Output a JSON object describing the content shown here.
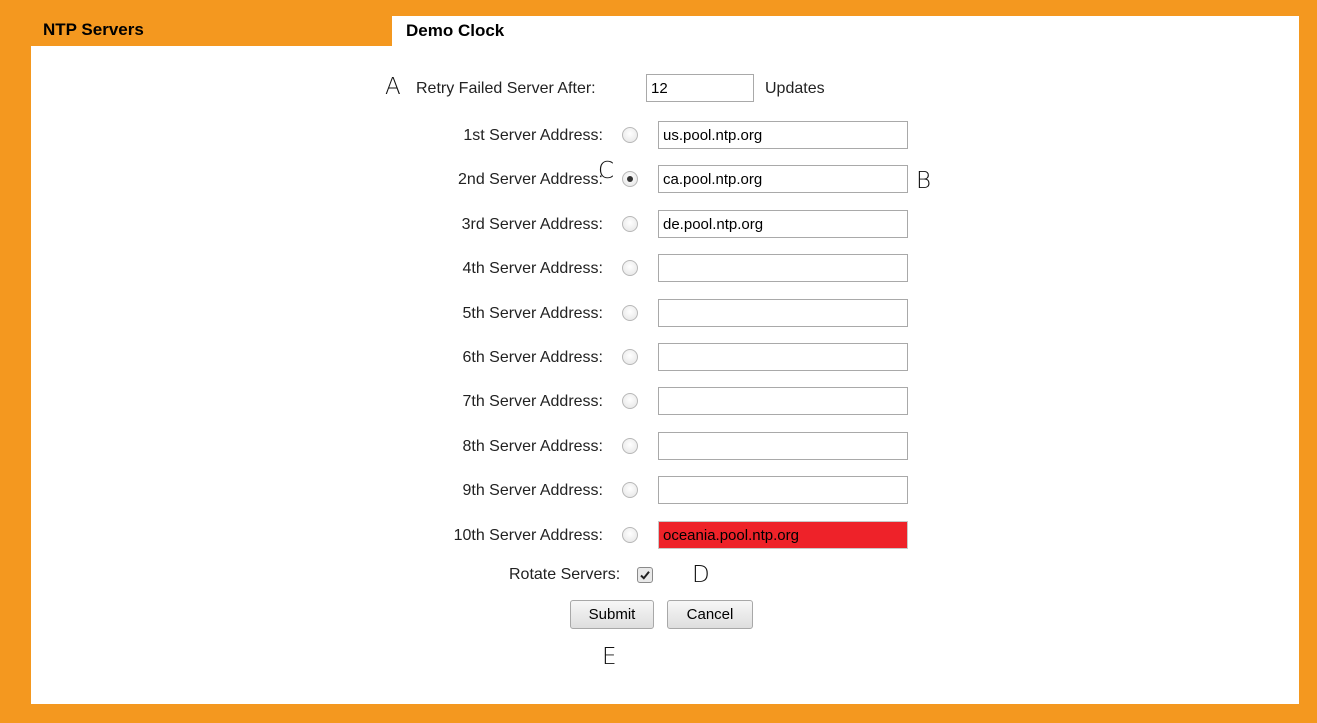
{
  "tabs": {
    "inactive_label": "NTP Servers",
    "active_label": "Demo Clock"
  },
  "retry": {
    "label": "Retry Failed Server After:",
    "value": "12",
    "unit": "Updates"
  },
  "servers": [
    {
      "label": "1st Server Address:",
      "value": "us.pool.ntp.org",
      "selected": false,
      "error": false
    },
    {
      "label": "2nd Server Address:",
      "value": "ca.pool.ntp.org",
      "selected": true,
      "error": false
    },
    {
      "label": "3rd Server Address:",
      "value": "de.pool.ntp.org",
      "selected": false,
      "error": false
    },
    {
      "label": "4th Server Address:",
      "value": "",
      "selected": false,
      "error": false
    },
    {
      "label": "5th Server Address:",
      "value": "",
      "selected": false,
      "error": false
    },
    {
      "label": "6th Server Address:",
      "value": "",
      "selected": false,
      "error": false
    },
    {
      "label": "7th Server Address:",
      "value": "",
      "selected": false,
      "error": false
    },
    {
      "label": "8th Server Address:",
      "value": "",
      "selected": false,
      "error": false
    },
    {
      "label": "9th Server Address:",
      "value": "",
      "selected": false,
      "error": false
    },
    {
      "label": "10th Server Address:",
      "value": "oceania.pool.ntp.org",
      "selected": false,
      "error": true
    }
  ],
  "rotate": {
    "label": "Rotate Servers:",
    "checked": true
  },
  "buttons": {
    "submit": "Submit",
    "cancel": "Cancel"
  },
  "annotations": {
    "a": "A",
    "b": "B",
    "c": "C",
    "d": "D",
    "e": "E"
  },
  "colors": {
    "frame": "#f4981f",
    "error_field": "#ee2229"
  }
}
